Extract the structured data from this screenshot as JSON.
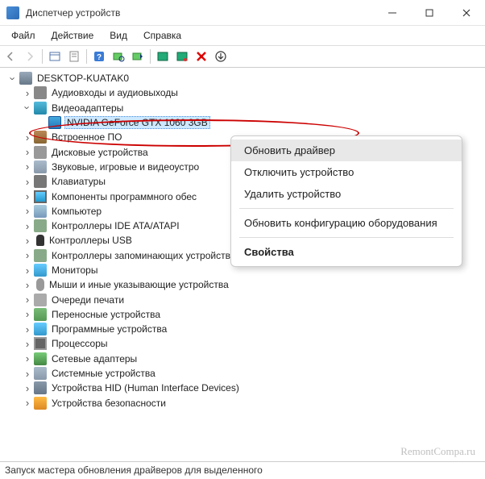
{
  "window": {
    "title": "Диспетчер устройств"
  },
  "menu": {
    "file": "Файл",
    "action": "Действие",
    "view": "Вид",
    "help": "Справка"
  },
  "tree": {
    "root": "DESKTOP-KUATAK0",
    "items": [
      "Аудиовходы и аудиовыходы",
      "Видеоадаптеры",
      "NVIDIA GeForce GTX 1060 3GB",
      "Встроенное ПО",
      "Дисковые устройства",
      "Звуковые, игровые и видеоустро",
      "Клавиатуры",
      "Компоненты программного обес",
      "Компьютер",
      "Контроллеры IDE ATA/ATAPI",
      "Контроллеры USB",
      "Контроллеры запоминающих устройств",
      "Мониторы",
      "Мыши и иные указывающие устройства",
      "Очереди печати",
      "Переносные устройства",
      "Программные устройства",
      "Процессоры",
      "Сетевые адаптеры",
      "Системные устройства",
      "Устройства HID (Human Interface Devices)",
      "Устройства безопасности"
    ]
  },
  "context_menu": {
    "update_driver": "Обновить драйвер",
    "disable": "Отключить устройство",
    "uninstall": "Удалить устройство",
    "scan": "Обновить конфигурацию оборудования",
    "properties": "Свойства"
  },
  "status": "Запуск мастера обновления драйверов для выделенного",
  "watermark": "RemontCompa.ru"
}
